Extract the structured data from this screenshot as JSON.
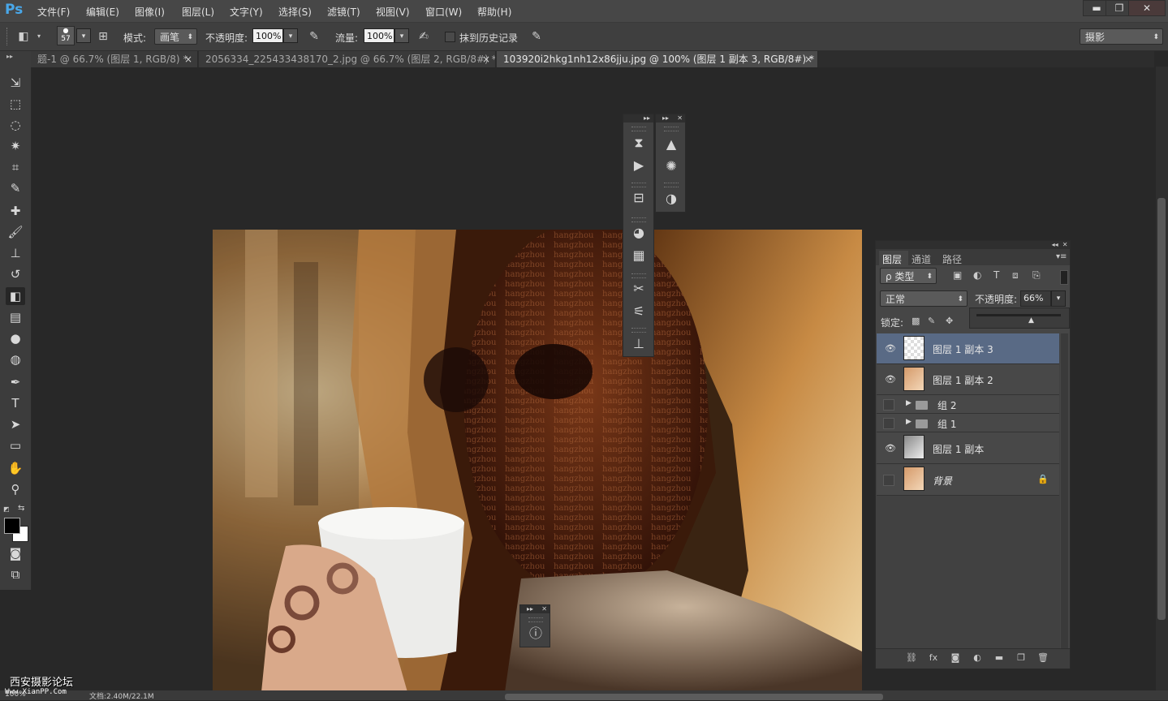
{
  "app": {
    "logo": "Ps"
  },
  "menu": [
    "文件(F)",
    "编辑(E)",
    "图像(I)",
    "图层(L)",
    "文字(Y)",
    "选择(S)",
    "滤镜(T)",
    "视图(V)",
    "窗口(W)",
    "帮助(H)"
  ],
  "window_controls": {
    "minimize": "▬",
    "restore": "❐",
    "close": "✕"
  },
  "options": {
    "brush_size": "57",
    "mode_label": "模式:",
    "mode_value": "画笔",
    "opacity_label": "不透明度:",
    "opacity_value": "100%",
    "flow_label": "流量:",
    "flow_value": "100%",
    "erase_history_label": "抹到历史记录",
    "workspace": "摄影"
  },
  "tabs": [
    {
      "label": "题-1 @ 66.7% (图层 1, RGB/8) *",
      "close": "×"
    },
    {
      "label": "2056334_225433438170_2.jpg @ 66.7% (图层 2, RGB/8#) *",
      "close": "×"
    },
    {
      "label": "103920i2hkg1nh12x86jju.jpg @ 100% (图层 1 副本 3, RGB/8#) *",
      "close": "×"
    }
  ],
  "tools": [
    {
      "name": "move-tool",
      "glyph": "⇲"
    },
    {
      "name": "marquee-tool",
      "glyph": "⬚"
    },
    {
      "name": "lasso-tool",
      "glyph": "◌"
    },
    {
      "name": "magic-wand-tool",
      "glyph": "✷"
    },
    {
      "name": "crop-tool",
      "glyph": "⌗"
    },
    {
      "name": "eyedropper-tool",
      "glyph": "✎"
    },
    {
      "name": "healing-brush-tool",
      "glyph": "✚"
    },
    {
      "name": "brush-tool",
      "glyph": "🖌"
    },
    {
      "name": "clone-stamp-tool",
      "glyph": "⊥"
    },
    {
      "name": "history-brush-tool",
      "glyph": "↺"
    },
    {
      "name": "eraser-tool",
      "glyph": "◧"
    },
    {
      "name": "gradient-tool",
      "glyph": "▤"
    },
    {
      "name": "blur-tool",
      "glyph": "●"
    },
    {
      "name": "dodge-tool",
      "glyph": "◍"
    },
    {
      "name": "pen-tool",
      "glyph": "✒"
    },
    {
      "name": "type-tool",
      "glyph": "T"
    },
    {
      "name": "path-selection-tool",
      "glyph": "➤"
    },
    {
      "name": "shape-tool",
      "glyph": "▭"
    },
    {
      "name": "hand-tool",
      "glyph": "✋"
    },
    {
      "name": "zoom-tool",
      "glyph": "⚲"
    }
  ],
  "layers_panel": {
    "tabs": [
      "图层",
      "通道",
      "路径"
    ],
    "filter_label": "ρ 类型",
    "blend_mode": "正常",
    "opacity_label": "不透明度:",
    "opacity_value": "66%",
    "lock_label": "锁定:",
    "layers": [
      {
        "name": "图层 1 副本 3",
        "visible": true,
        "selected": true,
        "type": "layer"
      },
      {
        "name": "图层 1 副本 2",
        "visible": true,
        "selected": false,
        "type": "layer"
      },
      {
        "name": "组 2",
        "visible": false,
        "selected": false,
        "type": "group"
      },
      {
        "name": "组 1",
        "visible": false,
        "selected": false,
        "type": "group"
      },
      {
        "name": "图层 1 副本",
        "visible": true,
        "selected": false,
        "type": "layer"
      },
      {
        "name": "背景",
        "visible": false,
        "selected": false,
        "type": "background"
      }
    ],
    "footer_icons": [
      "link-icon",
      "fx-icon",
      "mask-icon",
      "adjustment-icon",
      "folder-icon",
      "new-layer-icon",
      "trash-icon"
    ]
  },
  "watermark": {
    "line1": "西安摄影论坛",
    "line2": "Www.XianPP.Com"
  },
  "status": {
    "zoom": "100%",
    "doc": "文档:2.40M/22.1M"
  },
  "colors": {
    "accent": "#49a8ea",
    "selected_layer": "#596a85"
  }
}
